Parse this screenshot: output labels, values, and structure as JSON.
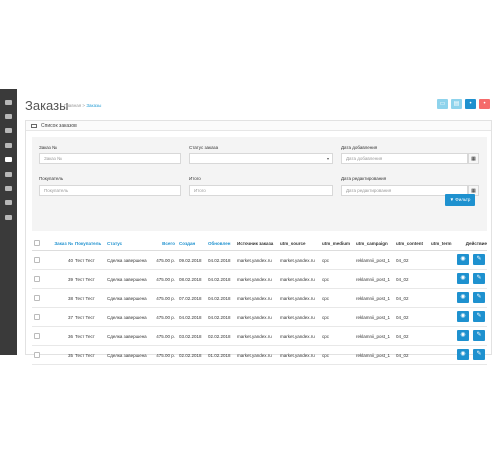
{
  "colors": {
    "primary": "#1e91cf",
    "info": "#5bc0de",
    "danger": "#f56b6b",
    "sidebar": "#3a3a3a"
  },
  "sidebar": {
    "icons": [
      "dashboard-icon",
      "tags-icon",
      "puzzle-icon",
      "monitor-icon",
      "cart-icon",
      "users-icon",
      "share-icon",
      "gear-icon",
      "chart-icon"
    ],
    "active": "cart-icon"
  },
  "page": {
    "title": "Заказы",
    "breadcrumb": {
      "home": "Главная",
      "sep": ">",
      "current": "Заказы"
    }
  },
  "toolbar": [
    "ticket-icon",
    "print-icon",
    "add-icon",
    "delete-icon"
  ],
  "panel": {
    "title": "Список заказов"
  },
  "filter": {
    "order_id_label": "Заказ №",
    "order_id_placeholder": "Заказ №",
    "status_label": "Статус заказа",
    "status_value": "",
    "date_added_label": "Дата добавления",
    "date_added_placeholder": "Дата добавления",
    "customer_label": "Покупатель",
    "customer_placeholder": "Покупатель",
    "total_label": "Итого",
    "total_placeholder": "Итого",
    "date_modified_label": "Дата редактирования",
    "date_modified_placeholder": "Дата редактирования",
    "button_label": "Фильтр"
  },
  "table": {
    "headers": {
      "order_id": "Заказ №",
      "customer": "Покупатель",
      "status": "Статус",
      "total": "Всего",
      "created": "Создан",
      "updated": "Обновлен",
      "source": "Источник заказа",
      "utm_source": "utm_source",
      "utm_medium": "utm_medium",
      "utm_campaign": "utm_campaign",
      "utm_content": "utm_content",
      "utm_term": "utm_term",
      "actions": "Действие"
    },
    "rows": [
      {
        "id": "40",
        "customer": "Тест Тест",
        "status": "Сделка завершена",
        "total": "475.00 р.",
        "created": "09.02.2018",
        "updated": "04.02.2018",
        "source": "market.yandex.ru",
        "utm_source": "market.yandex.ru",
        "utm_medium": "cpc",
        "utm_campaign": "reklamnii_post_1",
        "utm_content": "04_02",
        "utm_term": ""
      },
      {
        "id": "39",
        "customer": "Тест Тест",
        "status": "Сделка завершена",
        "total": "475.00 р.",
        "created": "08.02.2018",
        "updated": "04.02.2018",
        "source": "market.yandex.ru",
        "utm_source": "market.yandex.ru",
        "utm_medium": "cpc",
        "utm_campaign": "reklamnii_post_1",
        "utm_content": "04_02",
        "utm_term": ""
      },
      {
        "id": "38",
        "customer": "Тест Тест",
        "status": "Сделка завершена",
        "total": "475.00 р.",
        "created": "07.02.2018",
        "updated": "04.02.2018",
        "source": "market.yandex.ru",
        "utm_source": "market.yandex.ru",
        "utm_medium": "cpc",
        "utm_campaign": "reklamnii_post_1",
        "utm_content": "04_02",
        "utm_term": ""
      },
      {
        "id": "37",
        "customer": "Тест Тест",
        "status": "Сделка завершена",
        "total": "475.00 р.",
        "created": "04.02.2018",
        "updated": "04.02.2018",
        "source": "market.yandex.ru",
        "utm_source": "market.yandex.ru",
        "utm_medium": "cpc",
        "utm_campaign": "reklamnii_post_1",
        "utm_content": "04_02",
        "utm_term": ""
      },
      {
        "id": "36",
        "customer": "Тест Тест",
        "status": "Сделка завершена",
        "total": "475.00 р.",
        "created": "03.02.2018",
        "updated": "02.02.2018",
        "source": "market.yandex.ru",
        "utm_source": "market.yandex.ru",
        "utm_medium": "cpc",
        "utm_campaign": "reklamnii_post_1",
        "utm_content": "04_02",
        "utm_term": ""
      },
      {
        "id": "35",
        "customer": "Тест Тест",
        "status": "Сделка завершена",
        "total": "475.00 р.",
        "created": "02.02.2018",
        "updated": "01.02.2018",
        "source": "market.yandex.ru",
        "utm_source": "market.yandex.ru",
        "utm_medium": "cpc",
        "utm_campaign": "reklamnii_post_1",
        "utm_content": "04_02",
        "utm_term": ""
      }
    ],
    "row_actions": [
      "eye-icon",
      "pencil-icon"
    ]
  }
}
